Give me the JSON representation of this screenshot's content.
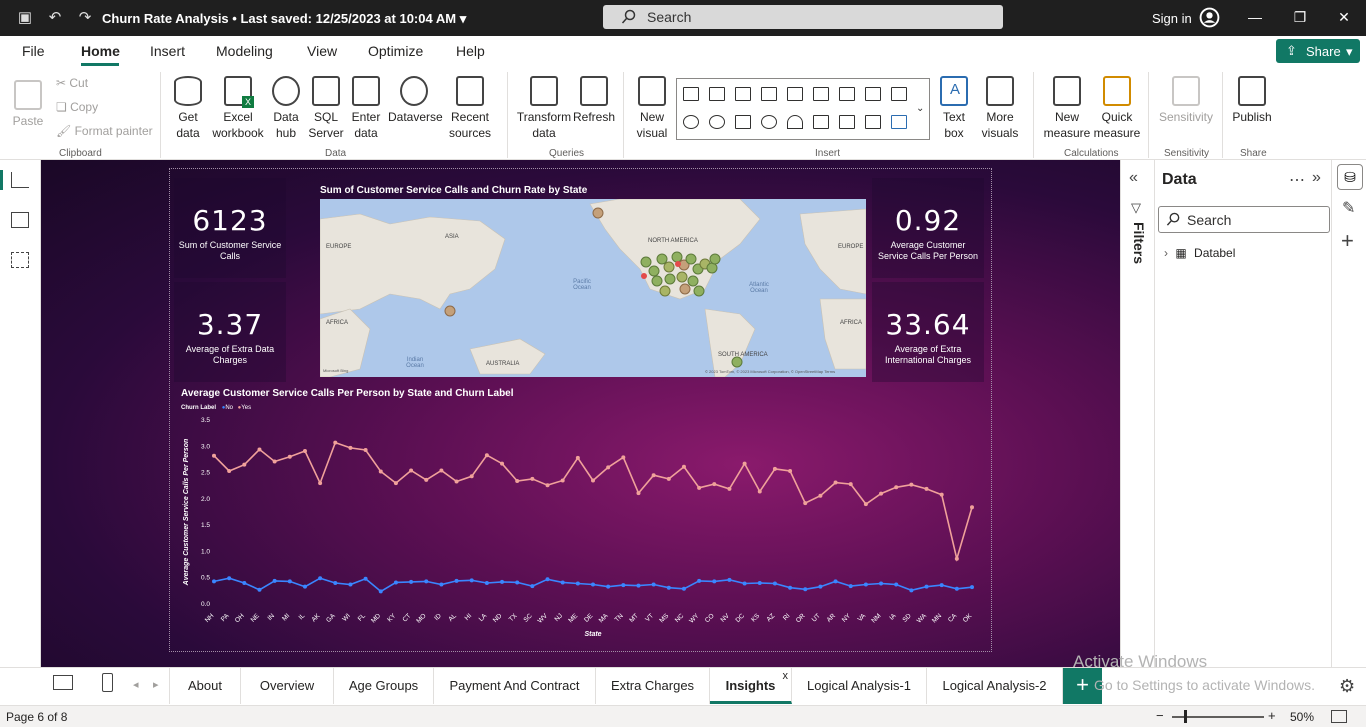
{
  "titlebar": {
    "title": "Churn Rate Analysis",
    "saved": "Last saved: 12/25/2023 at 10:04 AM",
    "search": "Search",
    "signin": "Sign in"
  },
  "menu": [
    "File",
    "Home",
    "Insert",
    "Modeling",
    "View",
    "Optimize",
    "Help"
  ],
  "share": "Share",
  "ribbon": {
    "paste": "Paste",
    "cut": "Cut",
    "copy": "Copy",
    "format_painter": "Format painter",
    "get_data": "Get data",
    "excel": "Excel workbook",
    "datahub": "Data hub",
    "sql": "SQL Server",
    "enter": "Enter data",
    "dataverse": "Dataverse",
    "recent": "Recent sources",
    "transform": "Transform data",
    "refresh": "Refresh",
    "new_visual": "New visual",
    "text_box": "Text box",
    "more_visuals": "More visuals",
    "new_measure": "New measure",
    "quick_measure": "Quick measure",
    "sensitivity": "Sensitivity",
    "publish": "Publish",
    "groups": {
      "clipboard": "Clipboard",
      "data": "Data",
      "queries": "Queries",
      "insert": "Insert",
      "calculations": "Calculations",
      "sensitivity": "Sensitivity",
      "share": "Share"
    }
  },
  "kpis": [
    {
      "value": "6123",
      "label": "Sum of Customer Service Calls"
    },
    {
      "value": "3.37",
      "label": "Average of Extra Data Charges"
    },
    {
      "value": "0.92",
      "label": "Average Customer Service Calls Per Person"
    },
    {
      "value": "33.64",
      "label": "Average of Extra International Charges"
    }
  ],
  "map": {
    "title": "Sum of Customer Service Calls and Churn Rate by State",
    "labels": {
      "europe_l": "EUROPE",
      "asia": "ASIA",
      "north_america": "NORTH AMERICA",
      "europe_r": "EUROPE",
      "africa_l": "AFRICA",
      "africa_r": "AFRICA",
      "pacific": "Pacific Ocean",
      "atlantic": "Atlantic Ocean",
      "indian": "Indian Ocean",
      "australia": "AUSTRALIA",
      "south_america": "SOUTH AMERICA"
    },
    "copyright": "© 2023 TomTom, © 2023 Microsoft Corporation, © OpenStreetMap  Terms",
    "bing": "Microsoft Bing"
  },
  "chart_data": {
    "type": "line",
    "title": "Average Customer Service Calls Per Person by State and Churn Label",
    "legend_title": "Churn Label",
    "xlabel": "State",
    "ylabel": "Average Customer Service Calls Per Person",
    "ylim": [
      0,
      3.5
    ],
    "yticks": [
      "0.0",
      "0.5",
      "1.0",
      "1.5",
      "2.0",
      "2.5",
      "3.0",
      "3.5"
    ],
    "categories": [
      "NH",
      "PA",
      "OH",
      "NE",
      "IN",
      "MI",
      "IL",
      "AK",
      "GA",
      "WI",
      "FL",
      "MD",
      "KY",
      "CT",
      "MO",
      "ID",
      "AL",
      "HI",
      "LA",
      "ND",
      "TX",
      "SC",
      "WV",
      "NJ",
      "ME",
      "DE",
      "MA",
      "TN",
      "MT",
      "VT",
      "MS",
      "NC",
      "WY",
      "CO",
      "NV",
      "DC",
      "KS",
      "AZ",
      "RI",
      "OR",
      "UT",
      "AR",
      "NY",
      "VA",
      "NM",
      "IA",
      "SD",
      "WA",
      "MN",
      "CA",
      "OK"
    ],
    "series": [
      {
        "name": "No",
        "color": "#3a86ff",
        "values": [
          0.43,
          0.49,
          0.4,
          0.27,
          0.44,
          0.43,
          0.33,
          0.49,
          0.4,
          0.37,
          0.48,
          0.24,
          0.41,
          0.42,
          0.43,
          0.37,
          0.44,
          0.45,
          0.4,
          0.42,
          0.41,
          0.34,
          0.47,
          0.41,
          0.39,
          0.37,
          0.33,
          0.36,
          0.35,
          0.37,
          0.31,
          0.29,
          0.44,
          0.43,
          0.46,
          0.39,
          0.4,
          0.39,
          0.31,
          0.28,
          0.33,
          0.43,
          0.34,
          0.37,
          0.39,
          0.37,
          0.26,
          0.33,
          0.36,
          0.29,
          0.32
        ]
      },
      {
        "name": "Yes",
        "color": "#f0a19a",
        "values": [
          2.82,
          2.53,
          2.65,
          2.94,
          2.71,
          2.8,
          2.91,
          2.3,
          3.07,
          2.97,
          2.93,
          2.52,
          2.3,
          2.54,
          2.36,
          2.54,
          2.33,
          2.43,
          2.83,
          2.67,
          2.34,
          2.38,
          2.26,
          2.35,
          2.78,
          2.35,
          2.6,
          2.79,
          2.11,
          2.45,
          2.38,
          2.61,
          2.21,
          2.28,
          2.19,
          2.67,
          2.14,
          2.57,
          2.53,
          1.92,
          2.06,
          2.31,
          2.28,
          1.9,
          2.1,
          2.22,
          2.27,
          2.19,
          2.08,
          0.86,
          1.84
        ]
      }
    ]
  },
  "data_pane": {
    "title": "Data",
    "search": "Search",
    "table": "Databel"
  },
  "filters": "Filters",
  "tabs": [
    "About",
    "Overview",
    "Age Groups",
    "Payment And Contract",
    "Extra Charges",
    "Insights",
    "Logical Analysis-1",
    "Logical Analysis-2"
  ],
  "active_tab": "Insights",
  "watermark": {
    "line1": "Activate Windows",
    "line2": "Go to Settings to activate Windows."
  },
  "status": {
    "page": "Page 6 of 8",
    "zoom": "50%"
  }
}
